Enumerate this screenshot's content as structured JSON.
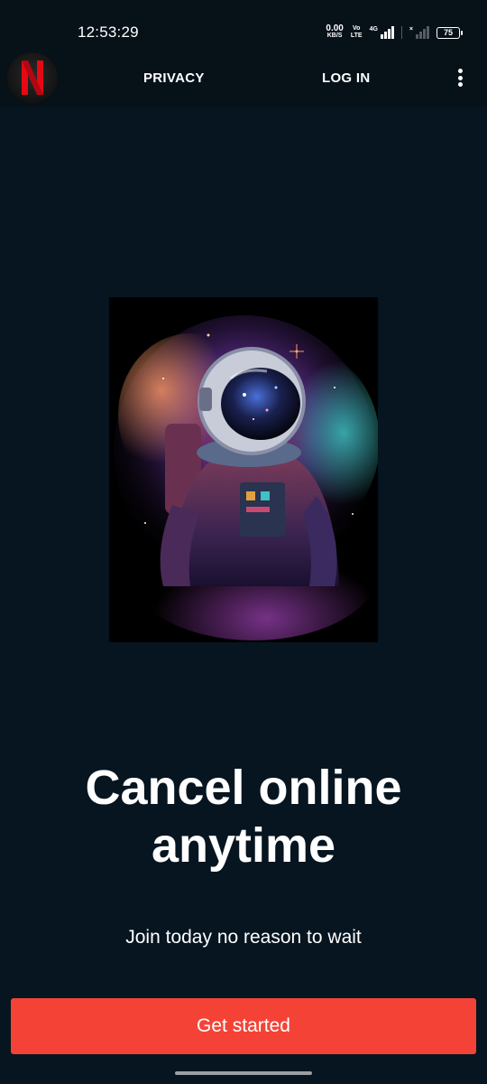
{
  "status_bar": {
    "time": "12:53:29",
    "net_speed_value": "0.00",
    "net_speed_unit": "KB/S",
    "volte_top": "Vo",
    "volte_bottom": "LTE",
    "network_type": "4G",
    "battery_level": "75"
  },
  "nav": {
    "logo_letter": "N",
    "privacy_label": "PRIVACY",
    "login_label": "LOG IN"
  },
  "main": {
    "headline": "Cancel online anytime",
    "subline": "Join today no reason to wait",
    "cta_label": "Get started"
  },
  "colors": {
    "background": "#061520",
    "brand_red": "#e50914",
    "cta": "#f44336"
  }
}
